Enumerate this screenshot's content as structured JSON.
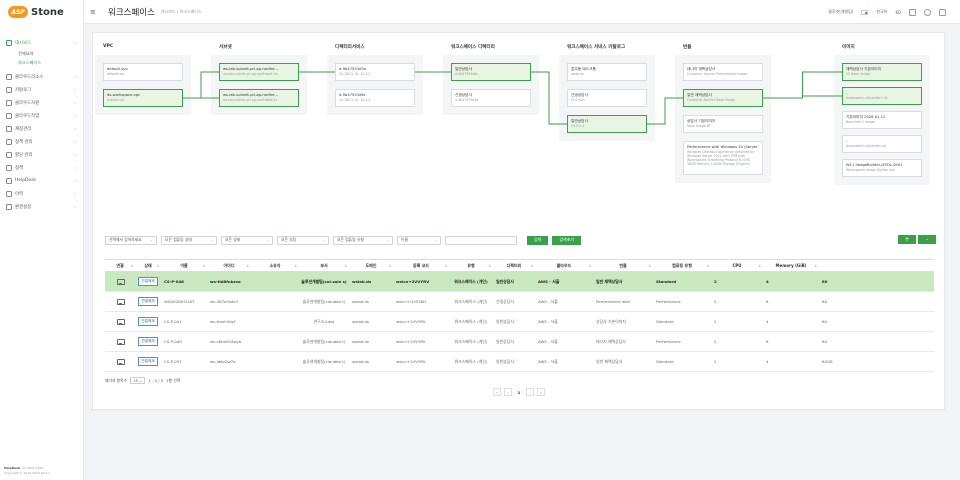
{
  "brand": {
    "logo_mark": "ASP",
    "logo_text": "Stone"
  },
  "sidebar": {
    "items": [
      {
        "label": "대시보드",
        "icon": "dashboard-icon",
        "active": true
      },
      {
        "label": "클라우드리소스",
        "icon": "cloud-icon"
      },
      {
        "label": "카탈로그",
        "icon": "catalog-icon"
      },
      {
        "label": "클라우드자원",
        "icon": "server-icon"
      },
      {
        "label": "클라우드작업",
        "icon": "task-icon"
      },
      {
        "label": "계정관리",
        "icon": "user-icon"
      },
      {
        "label": "정책 관리",
        "icon": "policy-icon"
      },
      {
        "label": "할당 관리",
        "icon": "allocation-icon"
      },
      {
        "label": "정책",
        "icon": "rule-icon"
      },
      {
        "label": "HelpDesk",
        "icon": "help-icon"
      },
      {
        "label": "이력",
        "icon": "history-icon"
      },
      {
        "label": "환경설정",
        "icon": "settings-icon"
      }
    ],
    "subitems": [
      {
        "label": "전체요약"
      },
      {
        "label": "워크스페이스",
        "active": true
      }
    ],
    "helpdesk": {
      "title": "HelpDesk",
      "phone": ": 02-3447-1280",
      "copyright": "Copyright © 2019-2024 Ea Inc."
    }
  },
  "topbar": {
    "title": "워크스페이스",
    "breadcrumb": "대시보드 / 워크스페이스",
    "user": "클루넷(개발팀)",
    "language": "한국어",
    "lang_code": "KO"
  },
  "flow": {
    "columns": [
      {
        "title": "VPC",
        "nodes": [
          {
            "name": "default-vpc",
            "sub": "default-vpc"
          },
          {
            "name": "ds-workspace-vpc",
            "sub": "subnet-vpc",
            "hl": true
          }
        ]
      },
      {
        "title": "서브넷",
        "nodes": [
          {
            "name": "ws-lab-subnet-pri-ap-northe...",
            "sub": "ws-lab-subnet-pri-ap-northeast-2a",
            "hl": true
          },
          {
            "name": "ws-lab-subnet-pri-ap-northe...",
            "sub": "ws-lab-subnet-pri-ap-northeast-2c",
            "hl": true
          }
        ]
      },
      {
        "title": "디렉터리서비스",
        "nodes": [
          {
            "name": "d-9b47553d3a",
            "sub": "10.185.5.10, 10.4.5"
          },
          {
            "name": "d-9b47553d6c",
            "sub": "10.185.5.10, 10.4.5"
          }
        ]
      },
      {
        "title": "워크스페이스 디렉터리",
        "nodes": [
          {
            "name": "일반상담사",
            "sub": "d-9b47553d6c",
            "hl": true
          },
          {
            "name": "선생상담사",
            "sub": "d-9b47553d3a"
          }
        ]
      },
      {
        "title": "워크스페이스 서비스 카탈로그",
        "nodes": [
          {
            "name": "업무용 테스크톱",
            "sub": "wsab.ds"
          },
          {
            "name": "선생상담사",
            "sub": "PCS-w2s"
          },
          {
            "name": "일반상담사",
            "sub": "CS-P-0.4",
            "hl": true
          }
        ]
      },
      {
        "title": "번들",
        "nodes": [
          {
            "name": "테너지 재택상담사",
            "sub": "Customer Service Performance Image"
          },
          {
            "name": "일반 재택상담사",
            "sub": "Customer Service Base Image",
            "hl": true
          },
          {
            "name": "상담사 기본이미지",
            "sub": "Base Image 87"
          },
          {
            "name": "Performance with Windows 10 (Server 2022 bas...",
            "sub": "Windows Desktop Experience provided by Windows Server 2022 with TPM with WorkSpaces Streaming Protocol 8 vCPU 16GB Memory 100GB Storage (English)",
            "tall": true
          }
        ]
      },
      {
        "title": "이미지",
        "nodes": [
          {
            "name": "재택상담사 기본이미지",
            "sub": "CS Base Image",
            "hl": true
          },
          {
            "name": "-",
            "sub": "Aspenware-callcenter-f- Jb",
            "hl": true
          },
          {
            "name": "기본이미지 2026.01.12",
            "sub": "Base test 1 image"
          },
          {
            "name": "-",
            "sub": "Aspenware-callcenter-jcb"
          },
          {
            "name": "W11 ImageBuilder-JEYOL-0501",
            "sub": "Workspaces Image Builder wid"
          }
        ]
      }
    ]
  },
  "filters": {
    "selects": [
      "선택해서 검색하세요",
      "모든 컴퓨팅 상태",
      "모든 상태",
      "모든 부팅",
      "모든 컴퓨팅 유형",
      "이름"
    ],
    "search_placeholder": "",
    "search_label": "검색",
    "reset_label": "검색초기",
    "add_label": "+",
    "more_label": "-"
  },
  "table": {
    "headers": [
      "연결",
      "상태",
      "이름",
      "아이디",
      "소유자",
      "부서",
      "도메인",
      "등록 코드",
      "유형",
      "디렉터리",
      "클라우드",
      "번들",
      "컴퓨팅 유형",
      "CPU",
      "Memory (GiB)",
      ""
    ],
    "rows": [
      {
        "selected": true,
        "status": "연결해제",
        "name": "CS-P-046",
        "id": "ws-tld8fnkzvo",
        "owner": "",
        "dept": "솔루션개발팀(col.sale s)",
        "domain": "wslab.ds",
        "reg": "wslcn+2VVYRV",
        "type": "워크스페이스 (개인)",
        "dir": "일반상담사",
        "cloud": "AWS - 서울",
        "bundle": "일반 재택상담사",
        "compute": "Standard",
        "cpu": "2",
        "mem": "4",
        "disk": "80"
      },
      {
        "selected": false,
        "status": "연결해제",
        "name": "WSAVIZNH1LKT",
        "id": "ws-587o5x6c2",
        "owner": "",
        "dept": "솔루션개발팀(cloudbo t)",
        "domain": "wslab.ds",
        "reg": "wslcn+Q3538H",
        "type": "워크스페이스 (개인)",
        "dir": "선생상담사",
        "cloud": "AWS - 서울",
        "bundle": "Performance with",
        "compute": "Performance",
        "cpu": "2",
        "mem": "8",
        "disk": "80"
      },
      {
        "selected": false,
        "status": "연결해제",
        "name": "CS-P-041",
        "id": "ws-trxxh3dyf",
        "owner": "",
        "dept": "연구소(Lab)",
        "domain": "wslab.ds",
        "reg": "wslcn+2VVYRV",
        "type": "워크스페이스 (개인)",
        "dir": "일반상담사",
        "cloud": "AWS - 서울",
        "bundle": "상담사 기본이미지",
        "compute": "Standard",
        "cpu": "2",
        "mem": "4",
        "disk": "80"
      },
      {
        "selected": false,
        "status": "연결해제",
        "name": "CS-P-040",
        "id": "ws-c8kb504wyb",
        "owner": "",
        "dept": "솔루션개발팀(cloudbo t)",
        "domain": "wslab.ds",
        "reg": "wslcn+2VVYRV",
        "type": "워크스페이스 (개인)",
        "dir": "일반상담사",
        "cloud": "AWS - 서울",
        "bundle": "테너지 재택상담사",
        "compute": "Performance",
        "cpu": "2",
        "mem": "8",
        "disk": "80"
      },
      {
        "selected": false,
        "status": "연결해제",
        "name": "CS-P-037",
        "id": "ws-ld6v2w7d",
        "owner": "",
        "dept": "솔루션개발팀(cloudbo t)",
        "domain": "wslab.ds",
        "reg": "wslcn+2VVYRV",
        "type": "워크스페이스 (개인)",
        "dir": "일반상담사",
        "cloud": "AWS - 서울",
        "bundle": "일반 재택상담사",
        "compute": "Standard",
        "cpu": "2",
        "mem": "4",
        "disk": "80GB"
      }
    ],
    "page_size_label": "페이지 항목수",
    "page_size": "15",
    "range": "1 - 5 / 5",
    "selected": "1행 선택"
  },
  "pagination": {
    "first": "«",
    "prev": "‹",
    "current": "1",
    "next": "›",
    "last": "»"
  },
  "colors": {
    "accent": "#3aa04a",
    "selected_row": "#c8e9bf",
    "highlight_node": "#e8f5e4"
  }
}
